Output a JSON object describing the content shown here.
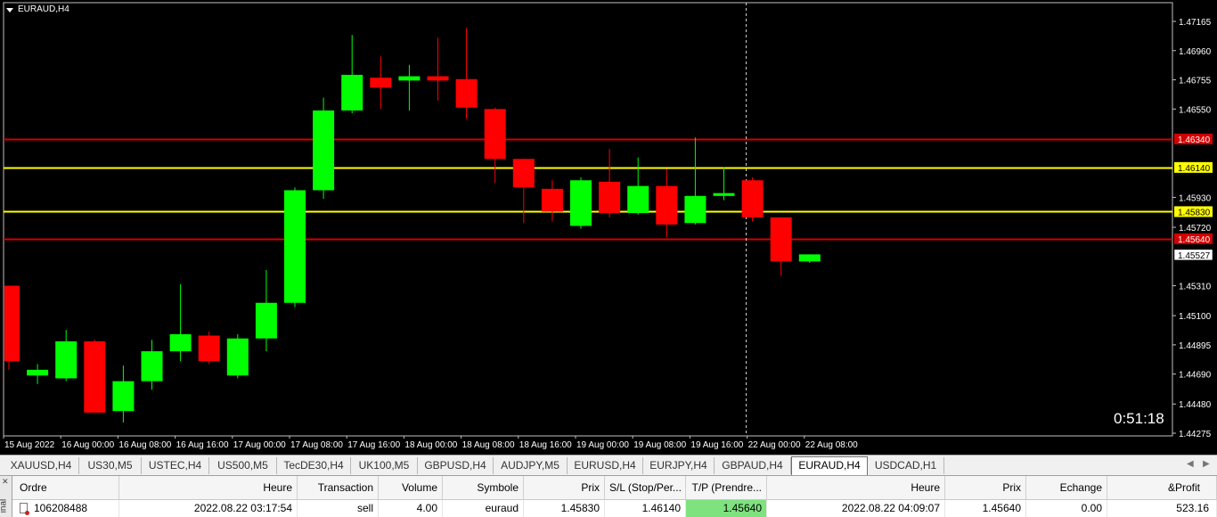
{
  "chart": {
    "symbol_title": "EURAUD,H4",
    "timer": "0:51:18",
    "price_min": 1.44275,
    "price_max": 1.47165,
    "colors": {
      "background": "#000000",
      "bull": "#00ff00",
      "bear": "#ff0000",
      "text": "#ffffff",
      "red_line": "#d20000",
      "yellow_line": "#ffff00"
    },
    "price_axis_labels": [
      "1.47165",
      "1.46960",
      "1.46755",
      "1.46550",
      "1.45930",
      "1.45720",
      "1.45310",
      "1.45100",
      "1.44895",
      "1.44690",
      "1.44480",
      "1.44275"
    ],
    "hlines": [
      {
        "price": 1.4634,
        "label": "1.46340",
        "color": "#d20000",
        "label_bg": "#d20000",
        "label_color": "#ffffff"
      },
      {
        "price": 1.4614,
        "label": "1.46140",
        "color": "#ffff00",
        "label_bg": "#ffff00",
        "label_color": "#000000"
      },
      {
        "price": 1.4583,
        "label": "1.45830",
        "color": "#ffff00",
        "label_bg": "#ffff00",
        "label_color": "#000000"
      },
      {
        "price": 1.4564,
        "label": "1.45640",
        "color": "#d20000",
        "label_bg": "#d20000",
        "label_color": "#ffffff"
      }
    ],
    "current_price": {
      "price": 1.45527,
      "label": "1.45527"
    },
    "time_labels": [
      "15 Aug 2022",
      "16 Aug 00:00",
      "16 Aug 08:00",
      "16 Aug 16:00",
      "17 Aug 00:00",
      "17 Aug 08:00",
      "17 Aug 16:00",
      "18 Aug 00:00",
      "18 Aug 08:00",
      "18 Aug 16:00",
      "19 Aug 00:00",
      "19 Aug 08:00",
      "19 Aug 16:00",
      "22 Aug 00:00",
      "22 Aug 08:00"
    ],
    "candles": [
      {
        "o": 1.4531,
        "h": 1.4531,
        "l": 1.4472,
        "c": 1.4478
      },
      {
        "o": 1.4468,
        "h": 1.4476,
        "l": 1.4462,
        "c": 1.4472
      },
      {
        "o": 1.4466,
        "h": 1.45,
        "l": 1.4464,
        "c": 1.4492
      },
      {
        "o": 1.4492,
        "h": 1.4493,
        "l": 1.4442,
        "c": 1.4442
      },
      {
        "o": 1.4443,
        "h": 1.4475,
        "l": 1.4435,
        "c": 1.4464
      },
      {
        "o": 1.4464,
        "h": 1.4493,
        "l": 1.4458,
        "c": 1.4485
      },
      {
        "o": 1.4485,
        "h": 1.4532,
        "l": 1.4478,
        "c": 1.4497
      },
      {
        "o": 1.4496,
        "h": 1.4499,
        "l": 1.4476,
        "c": 1.4478
      },
      {
        "o": 1.4468,
        "h": 1.4497,
        "l": 1.4466,
        "c": 1.4494
      },
      {
        "o": 1.4494,
        "h": 1.4542,
        "l": 1.4485,
        "c": 1.4519
      },
      {
        "o": 1.4519,
        "h": 1.46,
        "l": 1.4516,
        "c": 1.4598
      },
      {
        "o": 1.4598,
        "h": 1.4663,
        "l": 1.4592,
        "c": 1.4654
      },
      {
        "o": 1.4654,
        "h": 1.4707,
        "l": 1.4652,
        "c": 1.4679
      },
      {
        "o": 1.4677,
        "h": 1.4692,
        "l": 1.4655,
        "c": 1.467
      },
      {
        "o": 1.4675,
        "h": 1.4686,
        "l": 1.4654,
        "c": 1.4678
      },
      {
        "o": 1.4678,
        "h": 1.4705,
        "l": 1.4661,
        "c": 1.4675
      },
      {
        "o": 1.4676,
        "h": 1.4712,
        "l": 1.4648,
        "c": 1.4656
      },
      {
        "o": 1.4655,
        "h": 1.4656,
        "l": 1.4603,
        "c": 1.462
      },
      {
        "o": 1.462,
        "h": 1.462,
        "l": 1.4575,
        "c": 1.46
      },
      {
        "o": 1.4599,
        "h": 1.4605,
        "l": 1.4576,
        "c": 1.4583
      },
      {
        "o": 1.4573,
        "h": 1.4607,
        "l": 1.4571,
        "c": 1.4605
      },
      {
        "o": 1.4604,
        "h": 1.4627,
        "l": 1.4579,
        "c": 1.4582
      },
      {
        "o": 1.4582,
        "h": 1.4621,
        "l": 1.4581,
        "c": 1.4601
      },
      {
        "o": 1.4601,
        "h": 1.4613,
        "l": 1.4565,
        "c": 1.4574
      },
      {
        "o": 1.4575,
        "h": 1.4635,
        "l": 1.4574,
        "c": 1.4594
      },
      {
        "o": 1.4594,
        "h": 1.4614,
        "l": 1.4591,
        "c": 1.4596
      },
      {
        "o": 1.4605,
        "h": 1.4607,
        "l": 1.4576,
        "c": 1.4579
      },
      {
        "o": 1.4579,
        "h": 1.4579,
        "l": 1.4538,
        "c": 1.4548
      },
      {
        "o": 1.4548,
        "h": 1.4553,
        "l": 1.4547,
        "c": 1.4553
      }
    ]
  },
  "tabs": {
    "items": [
      "XAUUSD,H4",
      "US30,M5",
      "USTEC,H4",
      "US500,M5",
      "TecDE30,H4",
      "UK100,M5",
      "GBPUSD,H4",
      "AUDJPY,M5",
      "EURUSD,H4",
      "EURJPY,H4",
      "GBPAUD,H4",
      "EURAUD,H4",
      "USDCAD,H1"
    ],
    "active_index": 11
  },
  "terminal": {
    "side_label": "inal",
    "columns": [
      "Ordre",
      "Heure",
      "Transaction",
      "Volume",
      "Symbole",
      "Prix",
      "S/L (Stop/Per...",
      "T/P (Prendre...",
      "Heure",
      "Prix",
      "Echange",
      "&Profit"
    ],
    "row": [
      "106208488",
      "2022.08.22 03:17:54",
      "sell",
      "4.00",
      "euraud",
      "1.45830",
      "1.46140",
      "1.45640",
      "2022.08.22 04:09:07",
      "1.45640",
      "0.00",
      "523.16"
    ],
    "highlight_color": "#7ee27e"
  }
}
